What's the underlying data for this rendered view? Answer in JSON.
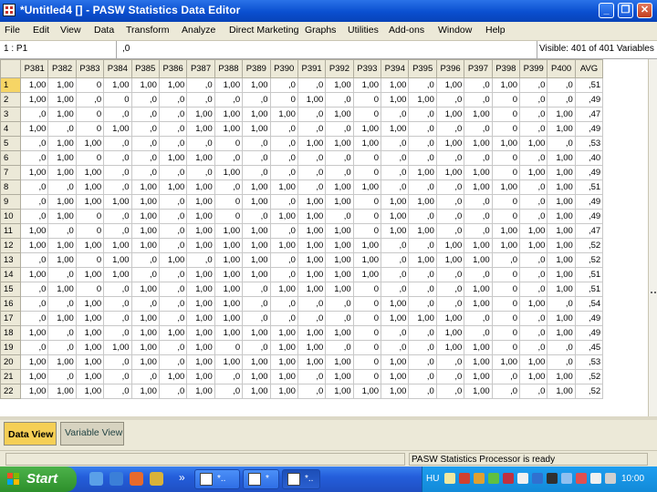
{
  "window": {
    "title": "*Untitled4 [] - PASW Statistics Data Editor",
    "minimize": "_",
    "maximize": "❐",
    "close": "✕"
  },
  "menu": [
    "File",
    "Edit",
    "View",
    "Data",
    "Transform",
    "Analyze",
    "Direct Marketing",
    "Graphs",
    "Utilities",
    "Add-ons",
    "Window",
    "Help"
  ],
  "cellbar": {
    "ref": "1 : P1",
    "value": ",0",
    "visible": "Visible: 401 of 401 Variables"
  },
  "grid": {
    "columns": [
      "P381",
      "P382",
      "P383",
      "P384",
      "P385",
      "P386",
      "P387",
      "P388",
      "P389",
      "P390",
      "P391",
      "P392",
      "P393",
      "P394",
      "P395",
      "P396",
      "P397",
      "P398",
      "P399",
      "P400",
      "AVG"
    ],
    "rows": [
      [
        "1,00",
        "1,00",
        "0",
        "1,00",
        "1,00",
        "1,00",
        ",0",
        "1,00",
        "1,00",
        ",0",
        ",0",
        "1,00",
        "1,00",
        "1,00",
        ",0",
        "1,00",
        ",0",
        "1,00",
        ",0",
        ",0",
        ",51"
      ],
      [
        "1,00",
        "1,00",
        ",0",
        "0",
        ",0",
        ",0",
        ",0",
        ",0",
        ",0",
        "0",
        "1,00",
        ",0",
        "0",
        "1,00",
        "1,00",
        ",0",
        ",0",
        "0",
        ",0",
        ",0",
        ",49"
      ],
      [
        ",0",
        "1,00",
        "0",
        ",0",
        ",0",
        ",0",
        "1,00",
        "1,00",
        "1,00",
        "1,00",
        ",0",
        "1,00",
        "0",
        ",0",
        ",0",
        "1,00",
        "1,00",
        "0",
        ",0",
        "1,00",
        ",47"
      ],
      [
        "1,00",
        ",0",
        "0",
        "1,00",
        ",0",
        ",0",
        "1,00",
        "1,00",
        "1,00",
        ",0",
        ",0",
        ",0",
        "1,00",
        "1,00",
        ",0",
        ",0",
        ",0",
        "0",
        ",0",
        "1,00",
        ",49"
      ],
      [
        ",0",
        "1,00",
        "1,00",
        ",0",
        ",0",
        ",0",
        ",0",
        "0",
        ",0",
        ",0",
        "1,00",
        "1,00",
        "1,00",
        ",0",
        ",0",
        "1,00",
        "1,00",
        "1,00",
        "1,00",
        ",0",
        ",53"
      ],
      [
        ",0",
        "1,00",
        "0",
        ",0",
        ",0",
        "1,00",
        "1,00",
        ",0",
        ",0",
        ",0",
        ",0",
        ",0",
        "0",
        ",0",
        ",0",
        ",0",
        ",0",
        "0",
        ",0",
        "1,00",
        ",40"
      ],
      [
        "1,00",
        "1,00",
        "1,00",
        ",0",
        ",0",
        ",0",
        ",0",
        "1,00",
        ",0",
        ",0",
        ",0",
        ",0",
        "0",
        ",0",
        "1,00",
        "1,00",
        "1,00",
        "0",
        "1,00",
        "1,00",
        ",49"
      ],
      [
        ",0",
        ",0",
        "1,00",
        ",0",
        "1,00",
        "1,00",
        "1,00",
        ",0",
        "1,00",
        "1,00",
        ",0",
        "1,00",
        "1,00",
        ",0",
        ",0",
        ",0",
        "1,00",
        "1,00",
        ",0",
        "1,00",
        ",51"
      ],
      [
        ",0",
        "1,00",
        "1,00",
        "1,00",
        "1,00",
        ",0",
        "1,00",
        "0",
        "1,00",
        ",0",
        "1,00",
        "1,00",
        "0",
        "1,00",
        "1,00",
        ",0",
        ",0",
        "0",
        ",0",
        "1,00",
        ",49"
      ],
      [
        ",0",
        "1,00",
        "0",
        ",0",
        "1,00",
        ",0",
        "1,00",
        "0",
        ",0",
        "1,00",
        "1,00",
        ",0",
        "0",
        "1,00",
        ",0",
        ",0",
        ",0",
        "0",
        ",0",
        "1,00",
        ",49"
      ],
      [
        "1,00",
        ",0",
        "0",
        ",0",
        "1,00",
        ",0",
        "1,00",
        "1,00",
        "1,00",
        ",0",
        "1,00",
        "1,00",
        "0",
        "1,00",
        "1,00",
        ",0",
        ",0",
        "1,00",
        "1,00",
        "1,00",
        ",47"
      ],
      [
        "1,00",
        "1,00",
        "1,00",
        "1,00",
        "1,00",
        ",0",
        "1,00",
        "1,00",
        "1,00",
        "1,00",
        "1,00",
        "1,00",
        "1,00",
        ",0",
        ",0",
        "1,00",
        "1,00",
        "1,00",
        "1,00",
        "1,00",
        ",52"
      ],
      [
        ",0",
        "1,00",
        "0",
        "1,00",
        ",0",
        "1,00",
        ",0",
        "1,00",
        "1,00",
        ",0",
        "1,00",
        "1,00",
        "1,00",
        ",0",
        "1,00",
        "1,00",
        "1,00",
        ",0",
        ",0",
        "1,00",
        ",52"
      ],
      [
        "1,00",
        ",0",
        "1,00",
        "1,00",
        ",0",
        ",0",
        "1,00",
        "1,00",
        "1,00",
        ",0",
        "1,00",
        "1,00",
        "1,00",
        ",0",
        ",0",
        ",0",
        ",0",
        "0",
        ",0",
        "1,00",
        ",51"
      ],
      [
        ",0",
        "1,00",
        "0",
        ",0",
        "1,00",
        ",0",
        "1,00",
        "1,00",
        ",0",
        "1,00",
        "1,00",
        "1,00",
        "0",
        ",0",
        ",0",
        ",0",
        "1,00",
        "0",
        ",0",
        "1,00",
        ",51"
      ],
      [
        ",0",
        ",0",
        "1,00",
        ",0",
        ",0",
        ",0",
        "1,00",
        "1,00",
        ",0",
        ",0",
        ",0",
        ",0",
        "0",
        "1,00",
        ",0",
        ",0",
        "1,00",
        "0",
        "1,00",
        ",0",
        ",54"
      ],
      [
        ",0",
        "1,00",
        "1,00",
        ",0",
        "1,00",
        ",0",
        "1,00",
        "1,00",
        ",0",
        ",0",
        ",0",
        ",0",
        "0",
        "1,00",
        "1,00",
        "1,00",
        ",0",
        "0",
        ",0",
        "1,00",
        ",49"
      ],
      [
        "1,00",
        ",0",
        "1,00",
        ",0",
        "1,00",
        "1,00",
        "1,00",
        "1,00",
        "1,00",
        "1,00",
        "1,00",
        "1,00",
        "0",
        ",0",
        ",0",
        "1,00",
        ",0",
        "0",
        ",0",
        "1,00",
        ",49"
      ],
      [
        ",0",
        ",0",
        "1,00",
        "1,00",
        "1,00",
        ",0",
        "1,00",
        "0",
        ",0",
        "1,00",
        "1,00",
        ",0",
        "0",
        ",0",
        ",0",
        "1,00",
        "1,00",
        "0",
        ",0",
        ",0",
        ",45"
      ],
      [
        "1,00",
        "1,00",
        "1,00",
        ",0",
        "1,00",
        ",0",
        "1,00",
        "1,00",
        "1,00",
        "1,00",
        "1,00",
        "1,00",
        "0",
        "1,00",
        ",0",
        ",0",
        "1,00",
        "1,00",
        "1,00",
        ",0",
        ",53"
      ],
      [
        "1,00",
        ",0",
        "1,00",
        ",0",
        ",0",
        "1,00",
        "1,00",
        ",0",
        "1,00",
        "1,00",
        ",0",
        "1,00",
        "0",
        "1,00",
        ",0",
        ",0",
        "1,00",
        ",0",
        "1,00",
        "1,00",
        ",52"
      ],
      [
        "1,00",
        "1,00",
        "1,00",
        ",0",
        "1,00",
        ",0",
        "1,00",
        ",0",
        "1,00",
        "1,00",
        ",0",
        "1,00",
        "1,00",
        "1,00",
        ",0",
        ",0",
        "1,00",
        ",0",
        ",0",
        "1,00",
        ",52"
      ]
    ]
  },
  "tabs": {
    "data_view": "Data View",
    "variable_view": "Variable View"
  },
  "status": {
    "message": "PASW Statistics Processor is ready"
  },
  "taskbar": {
    "start": "Start",
    "chevron": "»",
    "buttons": [
      "*..",
      "*",
      "*.."
    ],
    "language": "HU",
    "clock": "10:00"
  }
}
